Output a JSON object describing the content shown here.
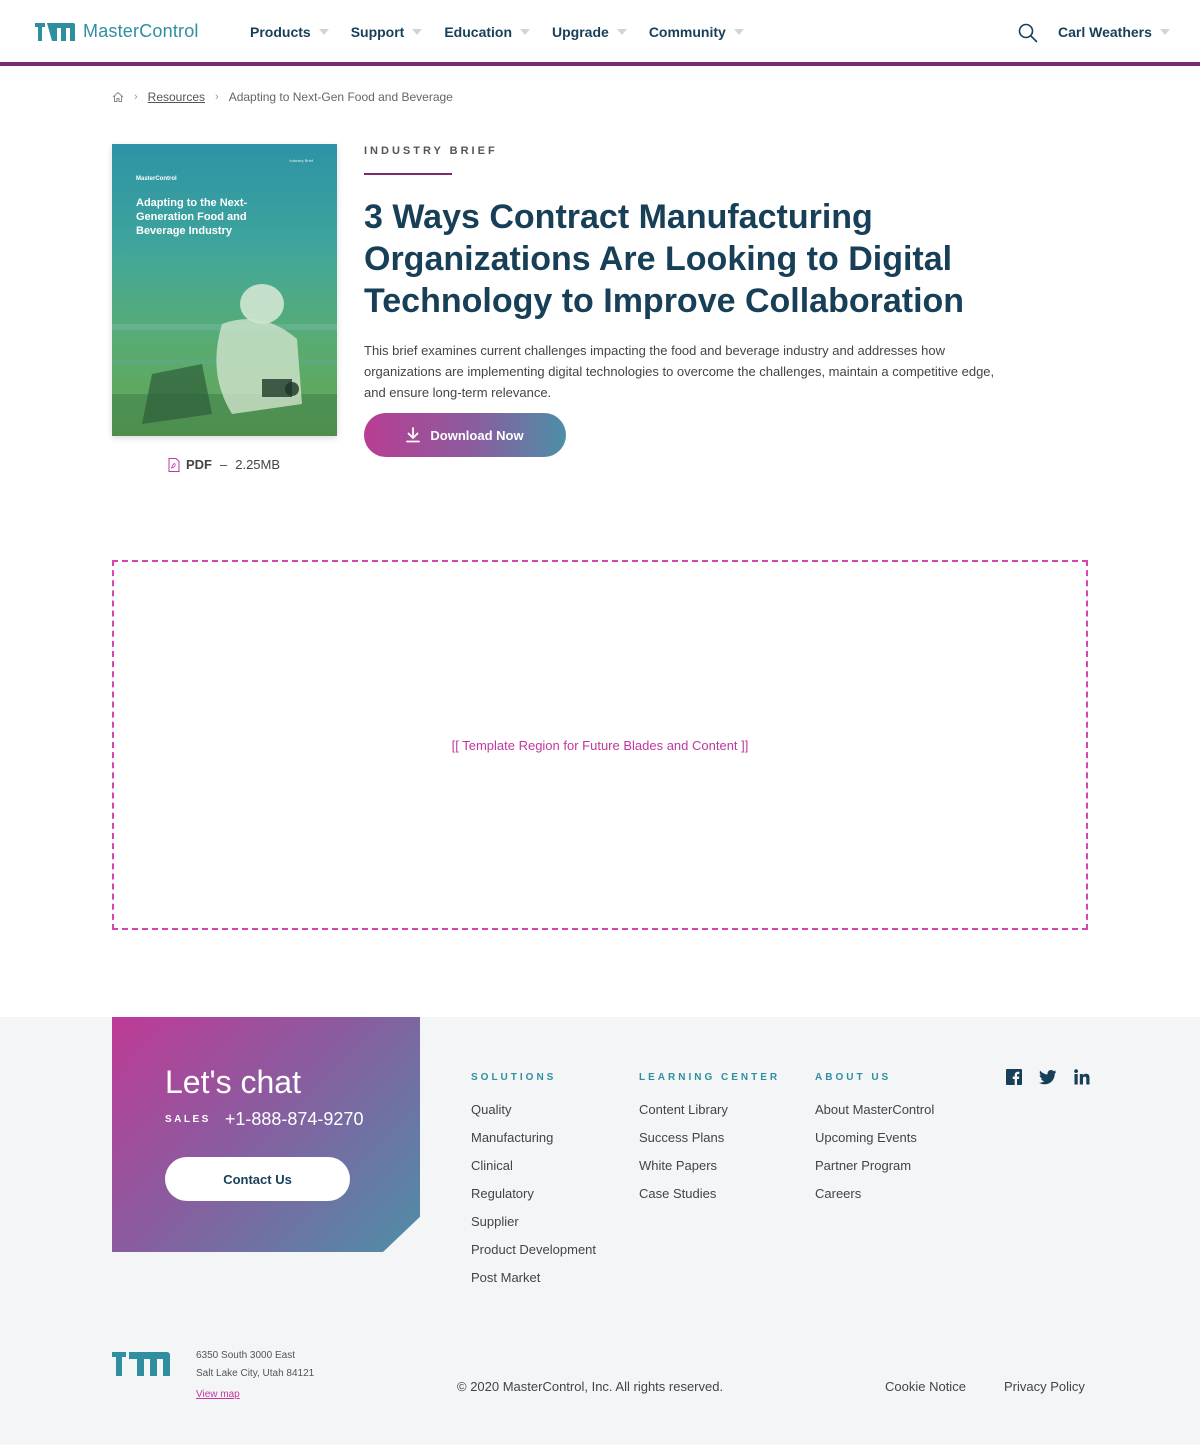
{
  "header": {
    "brand": "MasterControl",
    "nav": [
      {
        "label": "Products"
      },
      {
        "label": "Support"
      },
      {
        "label": "Education"
      },
      {
        "label": "Upgrade"
      },
      {
        "label": "Community"
      }
    ],
    "user": "Carl Weathers",
    "accent_color": "#7a2b6d",
    "brand_color": "#2f8fa0",
    "text_color": "#173f57"
  },
  "breadcrumb": {
    "home_icon": "home-icon",
    "items": [
      "Resources",
      "Adapting to Next-Gen Food and Beverage"
    ]
  },
  "resource": {
    "cover": {
      "brand": "MasterControl",
      "tag": "Industry Brief",
      "title": "Adapting to the Next-Generation Food and Beverage Industry"
    },
    "file_type": "PDF",
    "file_sep": "–",
    "file_size": "2.25MB",
    "eyebrow": "INDUSTRY BRIEF",
    "title": "3 Ways Contract Manufacturing Organizations Are Looking to Digital Technology to Improve Collaboration",
    "description": "This brief examines current challenges impacting the food and beverage industry and addresses how organizations are implementing digital technologies to overcome the challenges, maintain a competitive edge, and ensure long-term relevance.",
    "download_label": "Download Now"
  },
  "template_region": {
    "text": "[[ Template Region for Future Blades and Content ]]",
    "color": "#d447b1"
  },
  "footer": {
    "chat": {
      "title": "Let's chat",
      "sales_label": "SALES",
      "phone": "+1-888-874-9270",
      "contact_label": "Contact Us"
    },
    "columns": [
      {
        "heading": "SOLUTIONS",
        "items": [
          "Quality",
          "Manufacturing",
          "Clinical",
          "Regulatory",
          "Supplier",
          "Product Development",
          "Post Market"
        ]
      },
      {
        "heading": "LEARNING CENTER",
        "items": [
          "Content Library",
          "Success Plans",
          "White Papers",
          "Case Studies"
        ]
      },
      {
        "heading": "ABOUT US",
        "items": [
          "About MasterControl",
          "Upcoming Events",
          "Partner Program",
          "Careers"
        ]
      }
    ],
    "social": [
      "facebook-icon",
      "twitter-icon",
      "linkedin-icon"
    ],
    "address_line1": "6350 South 3000 East",
    "address_line2": "Salt Lake City, Utah 84121",
    "view_map": "View map",
    "copyright": "© 2020 MasterControl, Inc. All rights reserved.",
    "cookie_notice": "Cookie Notice",
    "privacy_policy": "Privacy Policy"
  }
}
